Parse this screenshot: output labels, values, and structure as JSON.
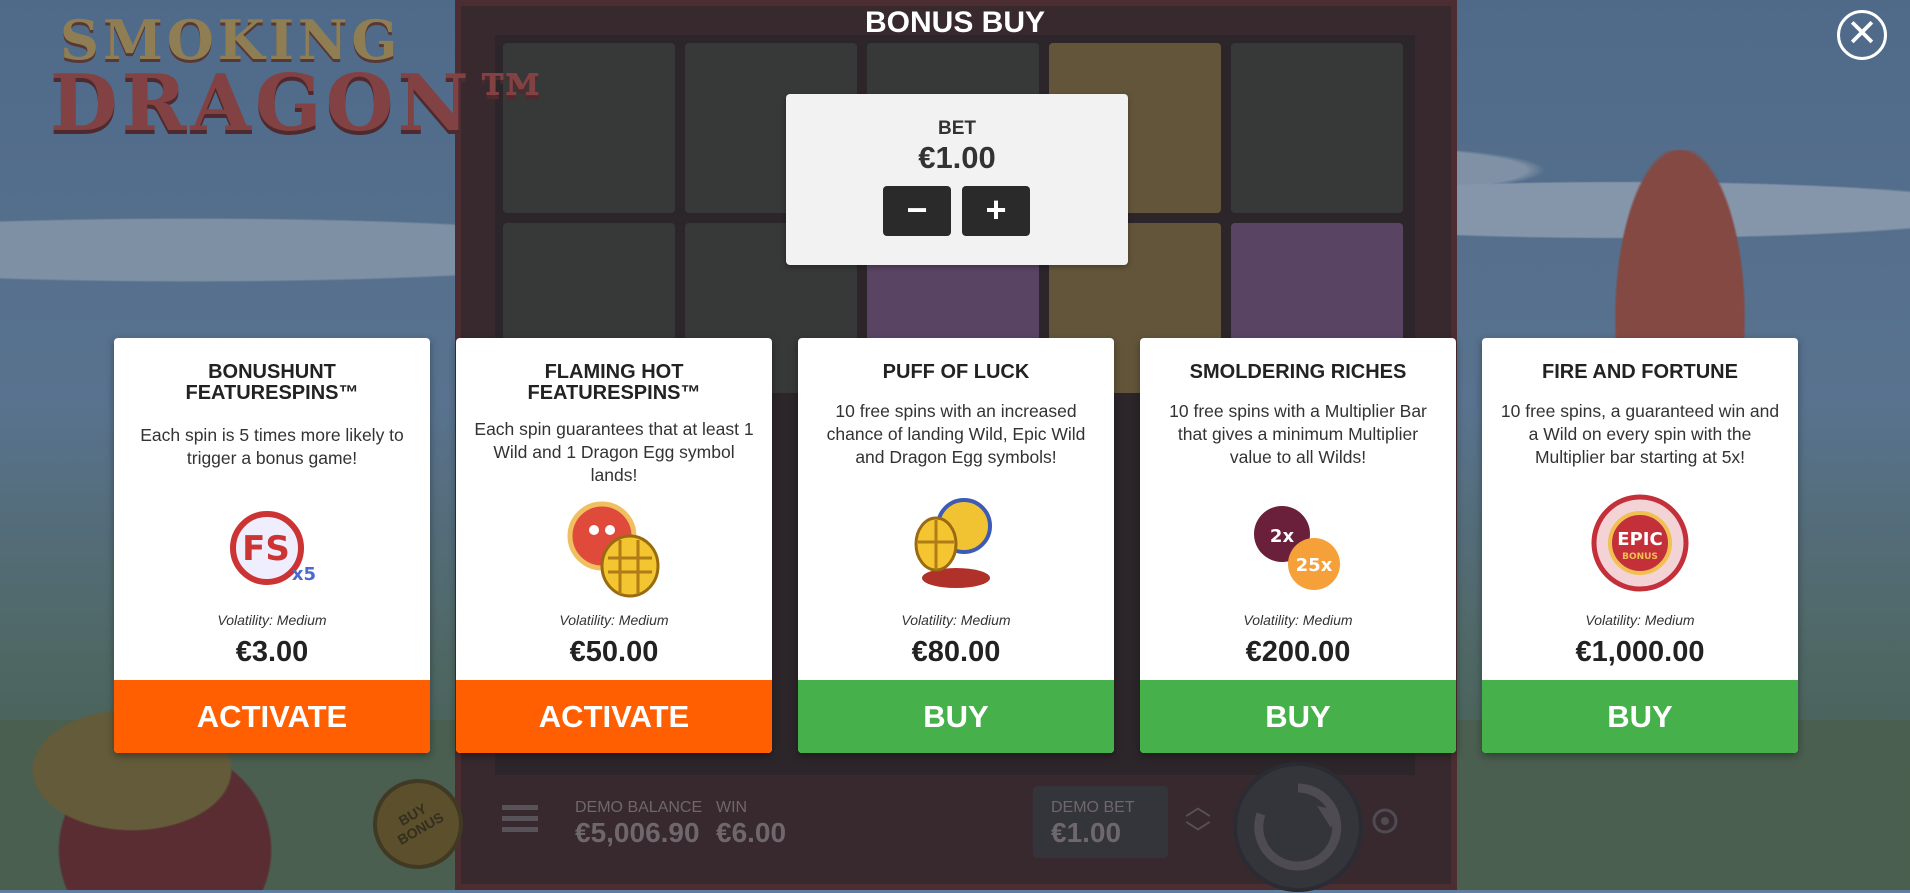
{
  "header": {
    "title": "BONUS BUY",
    "close_label": "✕"
  },
  "logo": {
    "line1": "SMOKING",
    "line2": "DRAGON™"
  },
  "bet": {
    "label": "BET",
    "value": "€1.00",
    "minus": "−",
    "plus": "+"
  },
  "cards": [
    {
      "title": "BONUSHUNT FEATURESPINS™",
      "description": "Each spin is 5 times more likely to trigger a bonus game!",
      "icon": "fs-x5-icon",
      "volatility": "Volatility: Medium",
      "price": "€3.00",
      "button": "ACTIVATE",
      "button_color": "#ff5f00"
    },
    {
      "title": "FLAMING HOT FEATURESPINS™",
      "description": "Each spin guarantees that at least 1 Wild and 1 Dragon Egg symbol lands!",
      "icon": "dragon-egg-icon",
      "volatility": "Volatility: Medium",
      "price": "€50.00",
      "button": "ACTIVATE",
      "button_color": "#ff5f00"
    },
    {
      "title": "PUFF OF LUCK",
      "description": "10 free spins with an increased chance of landing Wild, Epic Wild and Dragon Egg symbols!",
      "icon": "golden-dragon-icon",
      "volatility": "Volatility: Medium",
      "price": "€80.00",
      "button": "BUY",
      "button_color": "#46b04a"
    },
    {
      "title": "SMOLDERING RICHES",
      "description": "10 free spins with a Multiplier Bar that gives a minimum Multiplier value to all Wilds!",
      "icon": "multiplier-icon",
      "icon_texts": [
        "2x",
        "25x"
      ],
      "volatility": "Volatility: Medium",
      "price": "€200.00",
      "button": "BUY",
      "button_color": "#46b04a"
    },
    {
      "title": "FIRE AND FORTUNE",
      "description": "10 free spins, a guaranteed win and a Wild on every spin with the Multiplier bar starting at 5x!",
      "icon": "epic-bonus-icon",
      "icon_texts": [
        "EPIC",
        "BONUS"
      ],
      "volatility": "Volatility: Medium",
      "price": "€1,000.00",
      "button": "BUY",
      "button_color": "#46b04a"
    }
  ],
  "footer": {
    "buy_bonus": "BUY BONUS",
    "demo_balance_label": "DEMO BALANCE",
    "demo_balance": "€5,006.90",
    "win_label": "WIN",
    "win": "€6.00",
    "demo_bet_label": "DEMO BET",
    "demo_bet": "€1.00"
  },
  "colors": {
    "activate": "#ff5f00",
    "buy": "#46b04a",
    "overlay_bg": "#5f7fa0"
  }
}
